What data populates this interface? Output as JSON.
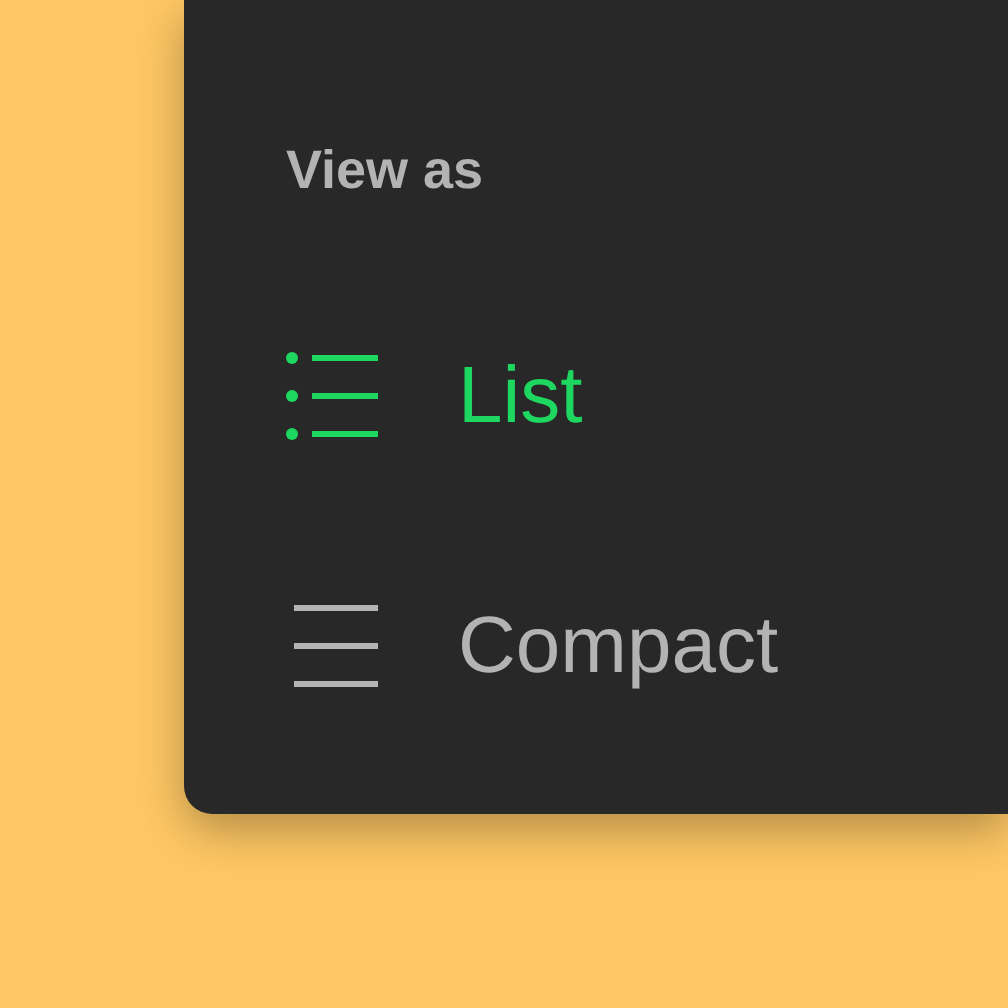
{
  "heading": "View as",
  "options": [
    {
      "label": "List",
      "kind": "list",
      "selected": true
    },
    {
      "label": "Compact",
      "kind": "compact",
      "selected": false
    }
  ]
}
